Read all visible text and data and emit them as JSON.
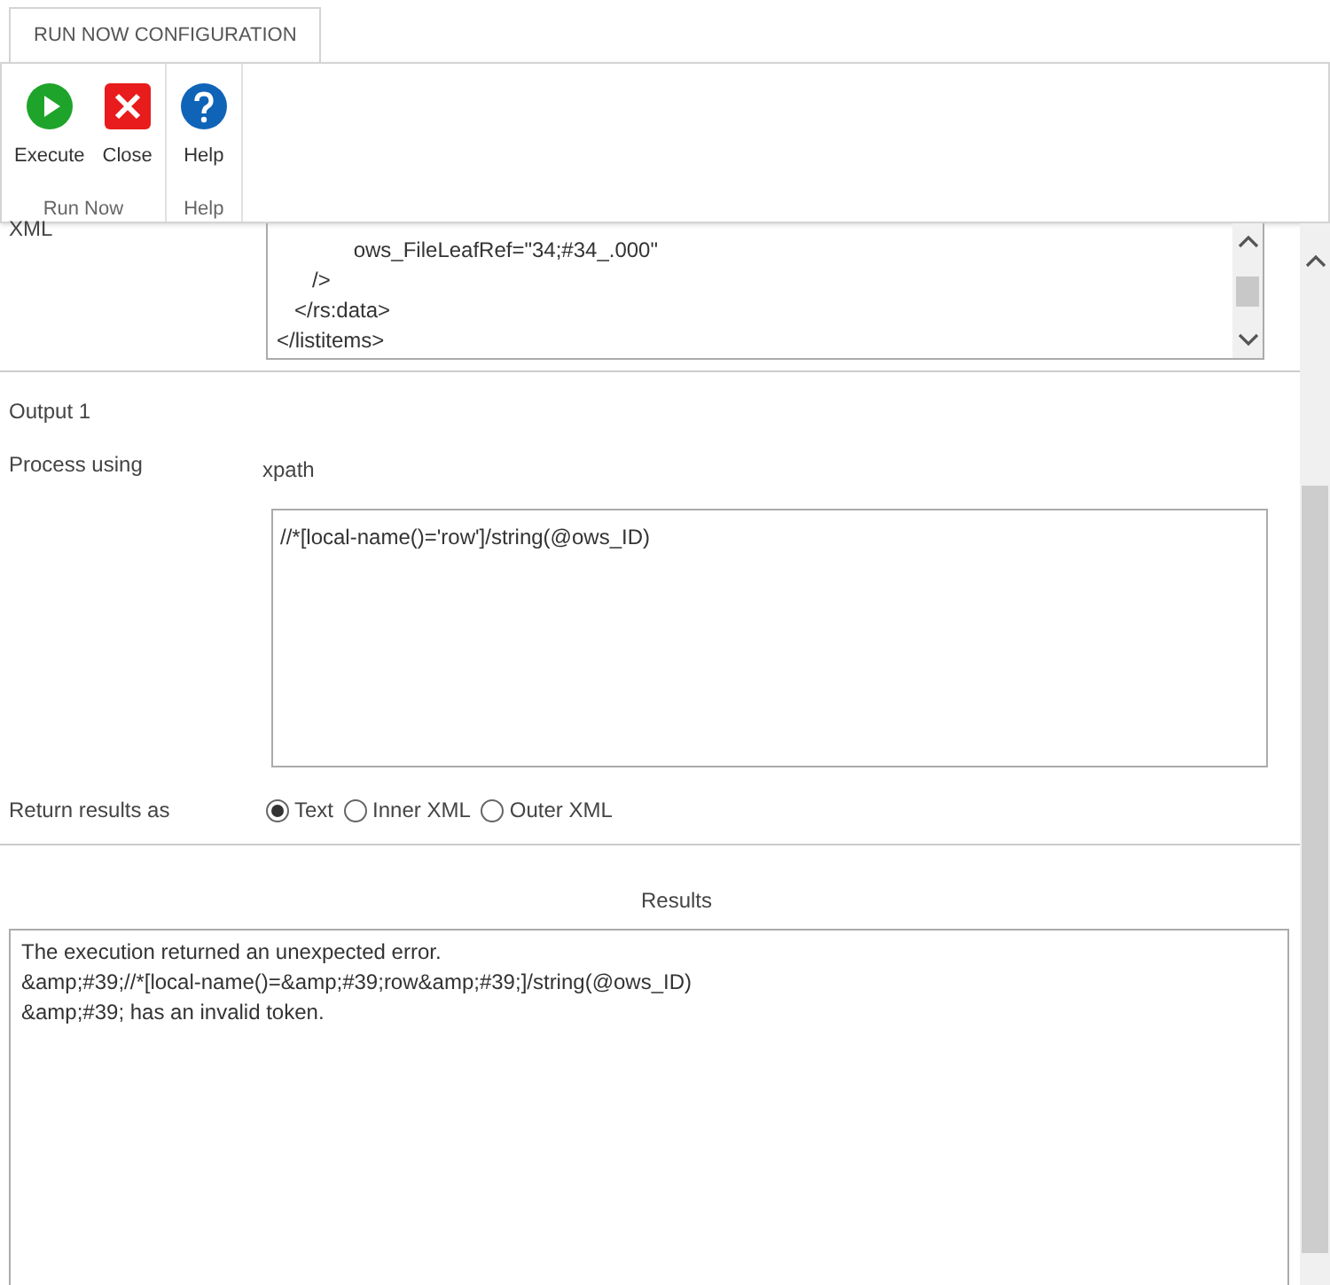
{
  "ribbon": {
    "tab": "RUN NOW CONFIGURATION",
    "groups": [
      {
        "label": "Run Now",
        "buttons": [
          {
            "kind": "execute",
            "label": "Execute"
          },
          {
            "kind": "close",
            "label": "Close"
          }
        ]
      },
      {
        "label": "Help",
        "buttons": [
          {
            "kind": "help",
            "label": "Help"
          }
        ]
      }
    ]
  },
  "xml": {
    "label": "XML",
    "lines": [
      "             ows_FileLeafRef=\"34;#34_.000\"",
      "      />",
      "   </rs:data>",
      "</listitems>"
    ]
  },
  "output": {
    "title": "Output 1",
    "process_label": "Process using",
    "process_value": "xpath",
    "query": "//*[local-name()='row']/string(@ows_ID)",
    "return_label": "Return results as",
    "options": [
      {
        "label": "Text",
        "selected": true
      },
      {
        "label": "Inner XML",
        "selected": false
      },
      {
        "label": "Outer XML",
        "selected": false
      }
    ]
  },
  "results": {
    "title": "Results",
    "text": "The execution returned an unexpected error.\n&amp;#39;//*[local-name()=&amp;#39;row&amp;#39;]/string(@ows_ID)\n&amp;#39; has an invalid token."
  }
}
